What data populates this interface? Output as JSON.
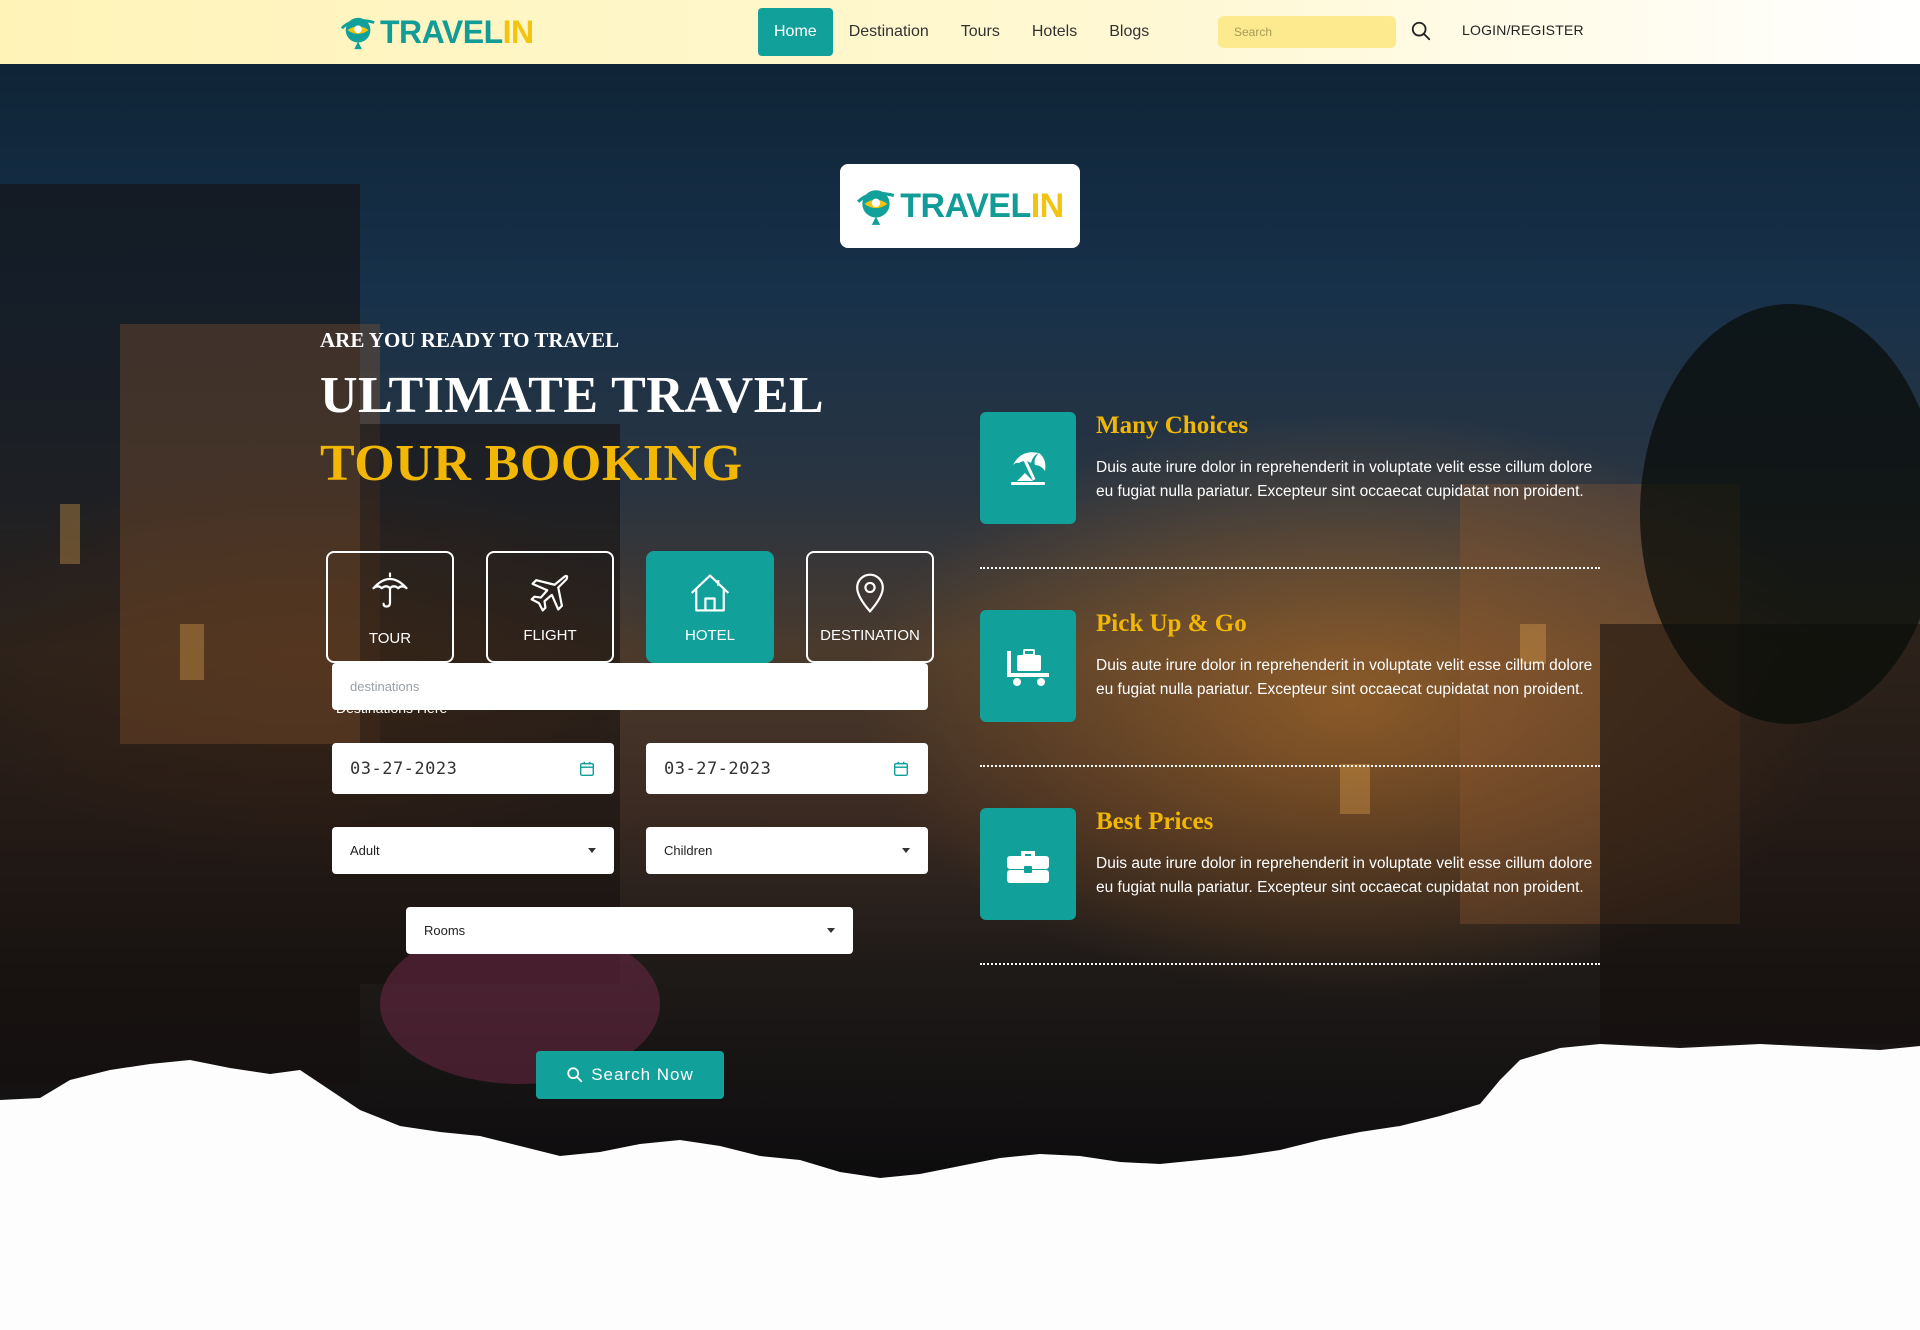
{
  "brand": {
    "name_part1": "TRAVEL",
    "name_part2": "IN"
  },
  "nav": {
    "items": [
      {
        "label": "Home",
        "active": true
      },
      {
        "label": "Destination",
        "active": false
      },
      {
        "label": "Tours",
        "active": false
      },
      {
        "label": "Hotels",
        "active": false
      },
      {
        "label": "Blogs",
        "active": false
      }
    ],
    "search_placeholder": "Search",
    "login_label": "LOGIN/REGISTER"
  },
  "hero": {
    "pre_title": "ARE YOU READY TO TRAVEL",
    "title_line1": "ULTIMATE TRAVEL",
    "title_line2": "TOUR BOOKING"
  },
  "booking": {
    "categories": [
      {
        "label": "TOUR",
        "icon": "umbrella-icon",
        "active": false
      },
      {
        "label": "FLIGHT",
        "icon": "airplane-icon",
        "active": false
      },
      {
        "label": "HOTEL",
        "icon": "house-icon",
        "active": true
      },
      {
        "label": "DESTINATION",
        "icon": "location-pin-icon",
        "active": false
      }
    ],
    "destination_label": "Destinations Here",
    "destination_placeholder": "destinations",
    "check_in": "03-27-2023",
    "check_out": "03-27-2023",
    "adult_label": "Adult",
    "children_label": "Children",
    "rooms_label": "Rooms",
    "search_button": "Search Now"
  },
  "features": [
    {
      "title": "Many Choices",
      "icon": "beach-umbrella-icon",
      "description": "Duis aute irure dolor in reprehenderit in voluptate velit esse cillum dolore eu fugiat nulla pariatur. Excepteur sint occaecat cupidatat non proident."
    },
    {
      "title": "Pick Up & Go",
      "icon": "luggage-cart-icon",
      "description": "Duis aute irure dolor in reprehenderit in voluptate velit esse cillum dolore eu fugiat nulla pariatur. Excepteur sint occaecat cupidatat non proident."
    },
    {
      "title": "Best Prices",
      "icon": "briefcase-icon",
      "description": "Duis aute irure dolor in reprehenderit in voluptate velit esse cillum dolore eu fugiat nulla pariatur. Excepteur sint occaecat cupidatat non proident."
    }
  ],
  "colors": {
    "accent": "#12a09b",
    "gold": "#f2b705",
    "nav_bg": "#fff6c6",
    "search_bg": "#fde98e"
  }
}
